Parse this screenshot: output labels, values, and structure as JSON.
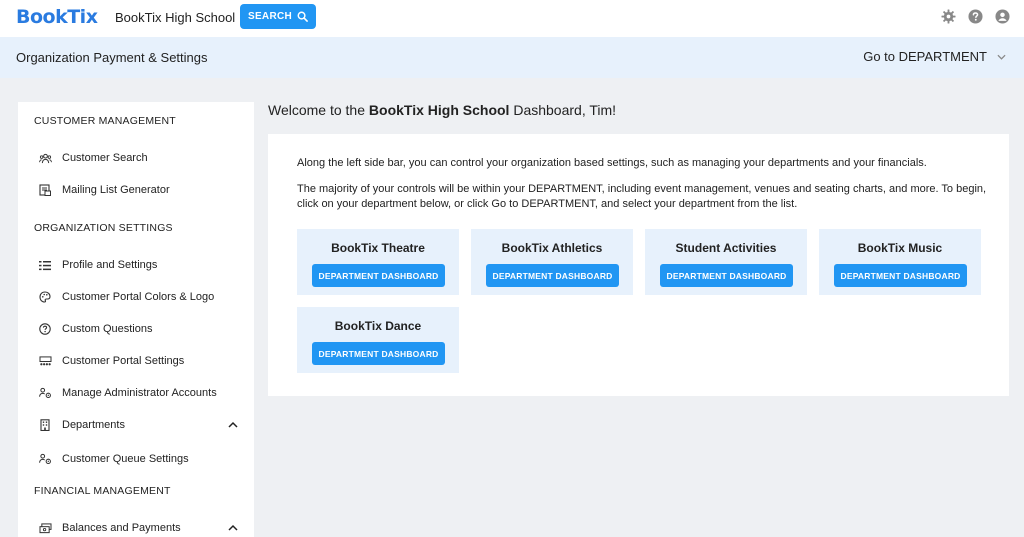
{
  "topbar": {
    "logo": "BookTix",
    "org_name": "BookTix High School",
    "search_label": "SEARCH"
  },
  "subheader": {
    "title": "Organization Payment & Settings",
    "goto_label": "Go to DEPARTMENT"
  },
  "sidebar": {
    "customer_management": "CUSTOMER MANAGEMENT",
    "customer_search": "Customer Search",
    "mailing_list": "Mailing List Generator",
    "organization_settings": "ORGANIZATION SETTINGS",
    "profile_settings": "Profile and Settings",
    "portal_colors": "Customer Portal Colors & Logo",
    "custom_questions": "Custom Questions",
    "portal_settings": "Customer Portal Settings",
    "admin_accounts": "Manage Administrator Accounts",
    "departments": "Departments",
    "queue_settings": "Customer Queue Settings",
    "financial_management": "FINANCIAL MANAGEMENT",
    "balances_payments": "Balances and Payments"
  },
  "main": {
    "welcome_prefix": "Welcome to the ",
    "welcome_org": "BookTix High School",
    "welcome_suffix": " Dashboard, Tim!",
    "para1": "Along the left side bar, you can control your organization based settings, such as managing your departments and your financials.",
    "para2": "The majority of your controls will be within your DEPARTMENT, including event management, venues and seating charts, and more. To begin, click on your department below, or click Go to DEPARTMENT, and select your department from the list.",
    "dept_button_label": "DEPARTMENT DASHBOARD",
    "departments": [
      {
        "name": "BookTix Theatre"
      },
      {
        "name": "BookTix Athletics"
      },
      {
        "name": "Student Activities"
      },
      {
        "name": "BookTix Music"
      },
      {
        "name": "BookTix Dance"
      }
    ]
  },
  "colors": {
    "brand_blue": "#2a7be0",
    "button_blue": "#2196f3",
    "light_blue": "#e7f1fc"
  }
}
